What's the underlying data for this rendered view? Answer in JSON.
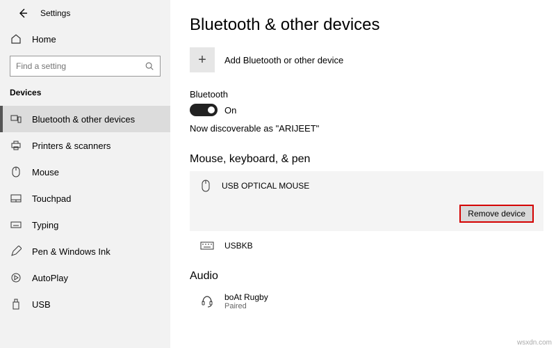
{
  "window": {
    "title": "Settings"
  },
  "home": {
    "label": "Home"
  },
  "search": {
    "placeholder": "Find a setting"
  },
  "category": {
    "title": "Devices"
  },
  "nav": {
    "items": [
      {
        "label": "Bluetooth & other devices"
      },
      {
        "label": "Printers & scanners"
      },
      {
        "label": "Mouse"
      },
      {
        "label": "Touchpad"
      },
      {
        "label": "Typing"
      },
      {
        "label": "Pen & Windows Ink"
      },
      {
        "label": "AutoPlay"
      },
      {
        "label": "USB"
      }
    ]
  },
  "page": {
    "title": "Bluetooth & other devices",
    "add_label": "Add Bluetooth or other device",
    "bt_label": "Bluetooth",
    "bt_state": "On",
    "discover_prefix": "Now discoverable as ",
    "discover_name": "\"ARIJEET\"",
    "section_mouse": "Mouse, keyboard, & pen",
    "device1": "USB OPTICAL MOUSE",
    "remove_label": "Remove device",
    "device2": "USBKB",
    "section_audio": "Audio",
    "audio_device": "boAt Rugby",
    "audio_status": "Paired"
  },
  "watermark": "wsxdn.com"
}
